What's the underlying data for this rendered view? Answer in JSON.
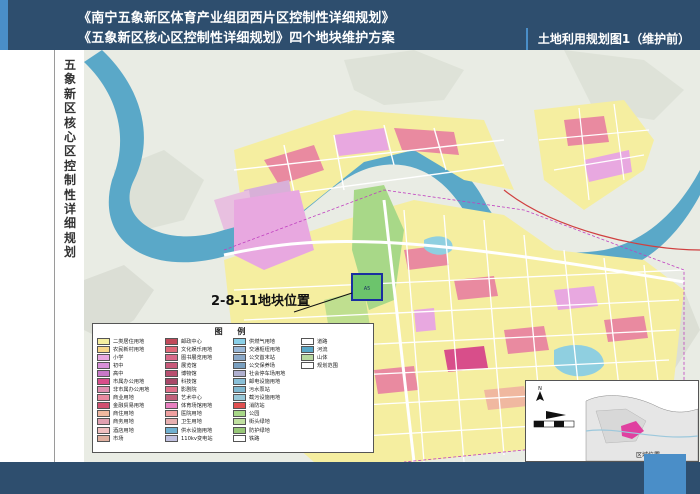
{
  "header": {
    "title_line1": "《南宁五象新区体育产业组团西片区控制性详细规划》",
    "title_line2": "《五象新区核心区控制性详细规划》四个地块维护方案",
    "sheet_label": "土地利用规划图1（维护前）"
  },
  "side_title": "五象新区核心区控制性详细规划",
  "map": {
    "plot_label": "2-8-11地块位置",
    "plot_tag": "A5",
    "colors": {
      "river": "#5aa8c8",
      "residential": "#f5eea0",
      "commercial": "#e98aa0",
      "education": "#e8a8e0",
      "green": "#a8d888",
      "water_body": "#8fcfe0",
      "admin": "#d84e8a",
      "road": "#ffffff",
      "highlight_border": "#1a2fa0"
    }
  },
  "legend": {
    "title": "图  例",
    "items": [
      {
        "label": "二类居住用地",
        "color": "#f5eea0"
      },
      {
        "label": "邮政中心",
        "color": "#c04a5a"
      },
      {
        "label": "供燃气用地",
        "color": "#8ad0e8"
      },
      {
        "label": "道路",
        "color": "#ffffff"
      },
      {
        "label": "农民新村用地",
        "color": "#f7d68a"
      },
      {
        "label": "文化娱乐用地",
        "color": "#e06a7a"
      },
      {
        "label": "交通枢纽用地",
        "color": "#9ab8d8"
      },
      {
        "label": "河流",
        "color": "#5aa8c8"
      },
      {
        "label": "小学",
        "color": "#e8a8e0"
      },
      {
        "label": "图书展览用地",
        "color": "#d86a8a"
      },
      {
        "label": "公交首末站",
        "color": "#8aa8c8"
      },
      {
        "label": "山体",
        "color": "#b8d8a0"
      },
      {
        "label": "初中",
        "color": "#d890d8"
      },
      {
        "label": "展览馆",
        "color": "#c85a7a"
      },
      {
        "label": "公交保养场",
        "color": "#7aa0c0"
      },
      {
        "label": "规划范围",
        "color": "#ffffff"
      },
      {
        "label": "高中",
        "color": "#c878c8"
      },
      {
        "label": "博物馆",
        "color": "#b85070"
      },
      {
        "label": "社会停车场用地",
        "color": "#b0b0d0"
      },
      {
        "label": "",
        "color": ""
      },
      {
        "label": "市属办公用地",
        "color": "#d84e8a"
      },
      {
        "label": "科技馆",
        "color": "#a84868"
      },
      {
        "label": "邮电设施用地",
        "color": "#8ac0d8"
      },
      {
        "label": "",
        "color": ""
      },
      {
        "label": "非市属办公用地",
        "color": "#e090b0"
      },
      {
        "label": "影剧院",
        "color": "#e0708a"
      },
      {
        "label": "污水泵站",
        "color": "#80b8d0"
      },
      {
        "label": "",
        "color": ""
      },
      {
        "label": "商业用地",
        "color": "#e98aa0"
      },
      {
        "label": "艺术中心",
        "color": "#c0607a"
      },
      {
        "label": "截污设施用地",
        "color": "#98c8d8"
      },
      {
        "label": "",
        "color": ""
      },
      {
        "label": "金融贸易用地",
        "color": "#d05070"
      },
      {
        "label": "体育场馆用地",
        "color": "#e880c0"
      },
      {
        "label": "消防站",
        "color": "#e05050"
      },
      {
        "label": "",
        "color": ""
      },
      {
        "label": "商住用地",
        "color": "#f0b8a0"
      },
      {
        "label": "医院用地",
        "color": "#f0a0a0"
      },
      {
        "label": "公园",
        "color": "#a8d888"
      },
      {
        "label": "",
        "color": ""
      },
      {
        "label": "商务用地",
        "color": "#e0a0b0"
      },
      {
        "label": "卫生用地",
        "color": "#e8b0b0"
      },
      {
        "label": "街头绿地",
        "color": "#c0e0a0"
      },
      {
        "label": "",
        "color": ""
      },
      {
        "label": "酒店用地",
        "color": "#f0c0c0"
      },
      {
        "label": "供水设施用地",
        "color": "#70b0d0"
      },
      {
        "label": "防护绿地",
        "color": "#98c878"
      },
      {
        "label": "",
        "color": ""
      },
      {
        "label": "市场",
        "color": "#e0b0a0"
      },
      {
        "label": "110kv变电站",
        "color": "#c0c0e0"
      },
      {
        "label": "铁路",
        "color": "#ffffff"
      },
      {
        "label": "",
        "color": ""
      }
    ]
  },
  "inset": {
    "label": "区域位置"
  }
}
